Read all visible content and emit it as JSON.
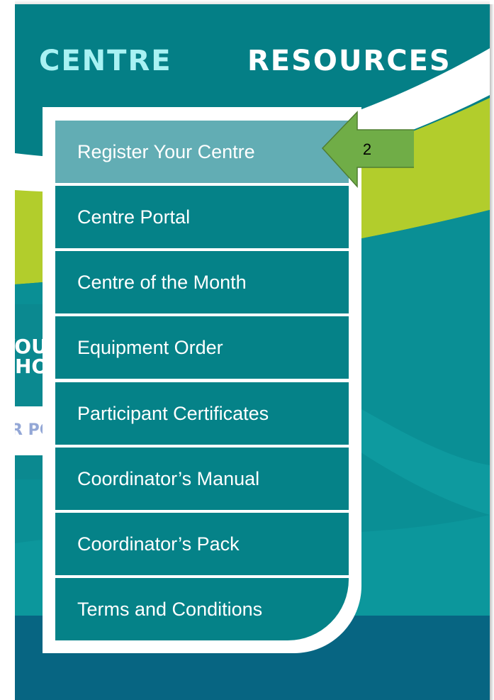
{
  "nav": {
    "centre_label": "CENTRE",
    "resources_label": "RESOURCES"
  },
  "side_card": {
    "heading": "YOU\nHO",
    "link_text": "R PC"
  },
  "menu": {
    "items": [
      {
        "label": "Register Your Centre",
        "active": true
      },
      {
        "label": "Centre Portal",
        "active": false
      },
      {
        "label": "Centre of the Month",
        "active": false
      },
      {
        "label": "Equipment Order",
        "active": false
      },
      {
        "label": "Participant Certificates",
        "active": false
      },
      {
        "label": "Coordinator’s Manual",
        "active": false
      },
      {
        "label": "Coordinator’s Pack",
        "active": false
      },
      {
        "label": "Terms and Conditions",
        "active": false
      }
    ]
  },
  "annotation": {
    "step_number": "2",
    "arrow_fill": "#70ad47",
    "arrow_stroke": "#507e32"
  },
  "colors": {
    "teal": "#058288",
    "teal_active": "#62adb4",
    "lime": "#b2cd2c",
    "light_cyan": "#a8f2f3",
    "footer_blue": "#076582"
  }
}
